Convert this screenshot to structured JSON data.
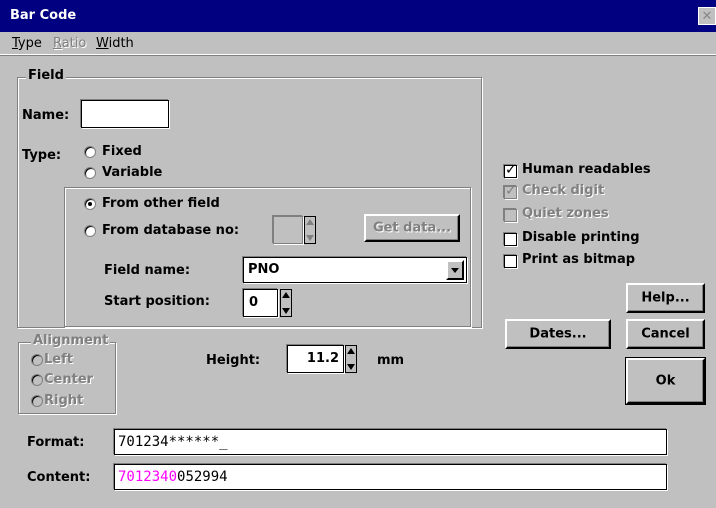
{
  "window": {
    "title": "Bar Code",
    "close_icon": "close-icon"
  },
  "menu": {
    "items": [
      {
        "label": "Type",
        "enabled": true
      },
      {
        "label": "Ratio",
        "enabled": false
      },
      {
        "label": "Width",
        "enabled": true
      }
    ]
  },
  "field_group": {
    "label": "Field",
    "name_label": "Name:",
    "name_value": "",
    "type_label": "Type:",
    "type_options": [
      {
        "label": "Fixed",
        "checked": false
      },
      {
        "label": "Variable",
        "checked": false
      }
    ],
    "source_options": [
      {
        "label": "From other field",
        "checked": true
      },
      {
        "label": "From database no:",
        "checked": false
      }
    ],
    "database_no_value": "",
    "get_data_button": "Get data...",
    "field_name_label": "Field name:",
    "field_name_value": "PNO",
    "start_position_label": "Start position:",
    "start_position_value": "0"
  },
  "alignment": {
    "label": "Alignment",
    "options": [
      "Left",
      "Center",
      "Right"
    ]
  },
  "height": {
    "label": "Height:",
    "value": "11.2",
    "unit": "mm"
  },
  "checkboxes": [
    {
      "label": "Human readables",
      "checked": true,
      "enabled": true
    },
    {
      "label": "Check digit",
      "checked": true,
      "enabled": false
    },
    {
      "label": "Quiet zones",
      "checked": false,
      "enabled": false
    },
    {
      "label": "Disable printing",
      "checked": false,
      "enabled": true
    },
    {
      "label": "Print as bitmap",
      "checked": false,
      "enabled": true
    }
  ],
  "buttons": {
    "help": "Help...",
    "dates": "Dates...",
    "cancel": "Cancel",
    "ok": "Ok"
  },
  "format": {
    "label": "Format:",
    "value": "701234******_"
  },
  "content": {
    "label": "Content:",
    "highlight": "7012340",
    "rest": "052994",
    "highlight_color": "#ff00ff"
  }
}
